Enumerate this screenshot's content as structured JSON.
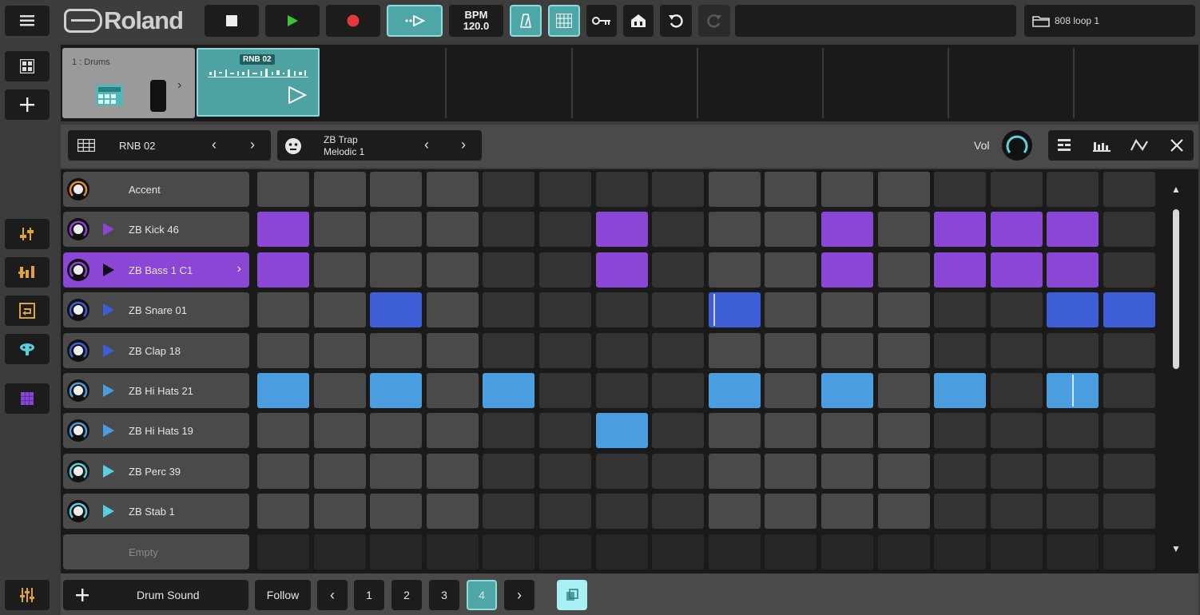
{
  "app": {
    "brand": "Roland"
  },
  "toolbar": {
    "bpm_label": "BPM",
    "bpm_value": "120.0",
    "file_name": "808 loop 1"
  },
  "sidebar": {
    "icons": [
      "menu-icon",
      "clip-view-icon",
      "add-icon",
      "mixer-icon",
      "effects-icon",
      "loop-icon",
      "sound-icon",
      "pattern-icon",
      "sliders-icon"
    ]
  },
  "track": {
    "label": "1 : Drums",
    "clip_name": "RNB 02"
  },
  "pattern": {
    "name": "RNB 02",
    "kit_line1": "ZB Trap",
    "kit_line2": "Melodic 1",
    "vol_label": "Vol"
  },
  "rows": [
    {
      "name": "Accent",
      "color": "#e58a2e",
      "has_play": false,
      "steps": []
    },
    {
      "name": "ZB Kick 46",
      "color": "#8a46d4",
      "has_play": true,
      "steps": [
        1,
        7,
        11,
        13,
        14,
        15
      ]
    },
    {
      "name": "ZB Bass 1 C1",
      "color": "#8a46d4",
      "has_play": true,
      "selected": true,
      "steps": [
        1,
        7,
        11,
        13,
        14,
        15
      ]
    },
    {
      "name": "ZB Snare 01",
      "color": "#3e5ed8",
      "has_play": true,
      "steps": [
        3,
        9,
        15,
        16
      ]
    },
    {
      "name": "ZB Clap 18",
      "color": "#3e5ed8",
      "has_play": true,
      "steps": []
    },
    {
      "name": "ZB Hi Hats 21",
      "color": "#4a9ee0",
      "has_play": true,
      "steps": [
        1,
        3,
        5,
        9,
        11,
        13,
        15
      ]
    },
    {
      "name": "ZB Hi Hats 19",
      "color": "#4a9ee0",
      "has_play": true,
      "steps": [
        7
      ]
    },
    {
      "name": "ZB Perc 39",
      "color": "#57d0e0",
      "has_play": true,
      "steps": []
    },
    {
      "name": "ZB Stab 1",
      "color": "#57d0e0",
      "has_play": true,
      "steps": []
    },
    {
      "name": "Empty",
      "color": "#666666",
      "has_play": false,
      "empty": true,
      "steps": []
    }
  ],
  "bottom": {
    "add_label": "Drum Sound",
    "follow_label": "Follow",
    "pages": [
      "1",
      "2",
      "3",
      "4"
    ],
    "active_page": "4"
  },
  "colors": {
    "accent_teal": "#4fa6a6",
    "step_light": "#4a4a4a",
    "step_dark": "#333333",
    "step_empty": "#262626"
  }
}
